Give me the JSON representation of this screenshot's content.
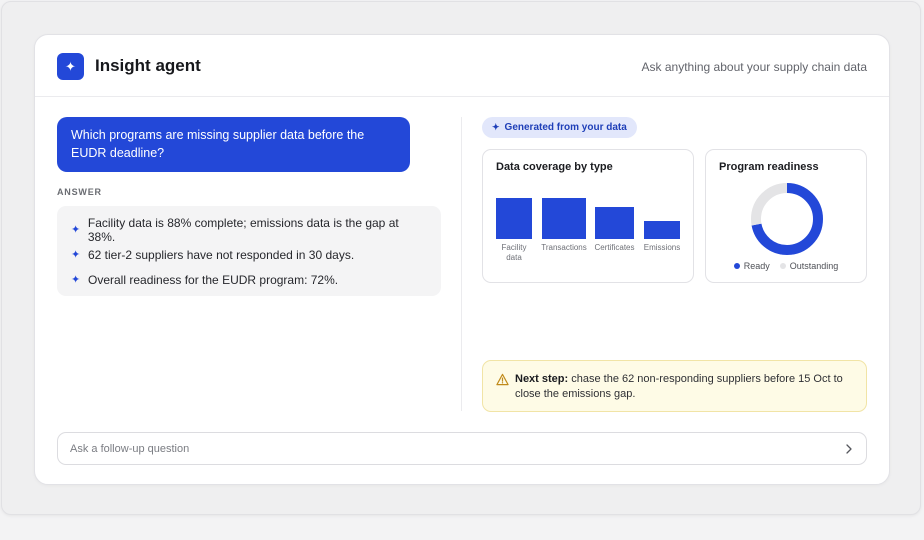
{
  "header": {
    "logo_icon": "sparkle-icon",
    "title": "Insight agent",
    "subtitle": "Ask anything about your supply chain data"
  },
  "conversation": {
    "question": "Which programs are missing supplier data before the EUDR deadline?",
    "answer_label": "ANSWER",
    "answer_items": [
      "Facility data is 88% complete; emissions data is the gap at 38%.",
      "62 tier-2 suppliers have not responded in 30 days.",
      "Overall readiness for the EUDR program: 72%."
    ]
  },
  "generated_chip": "Generated from your data",
  "next_step": {
    "label": "Next step:",
    "text": " chase the 62 non-responding suppliers before 15 Oct to close the emissions gap."
  },
  "followup": {
    "placeholder": "Ask a follow-up question"
  },
  "colors": {
    "accent": "#2348d8",
    "outstanding": "#e4e4e6",
    "warning_bg": "#fefbe6"
  },
  "chart_data": [
    {
      "type": "bar",
      "title": "Data coverage by type",
      "categories": [
        "Facility data",
        "Transactions",
        "Certificates",
        "Emissions"
      ],
      "category_lines": [
        [
          "Facility",
          "data"
        ],
        [
          "Transactions"
        ],
        [
          "Certificates"
        ],
        [
          "Emissions"
        ]
      ],
      "values": [
        88,
        87,
        68,
        38
      ],
      "ylim": [
        0,
        100
      ],
      "xlabel": "",
      "ylabel": "",
      "grid": false,
      "legend": "none"
    },
    {
      "type": "pie",
      "title": "Program readiness",
      "labels": [
        "Ready",
        "Outstanding"
      ],
      "values": [
        72,
        28
      ],
      "legend": "bottom"
    }
  ]
}
